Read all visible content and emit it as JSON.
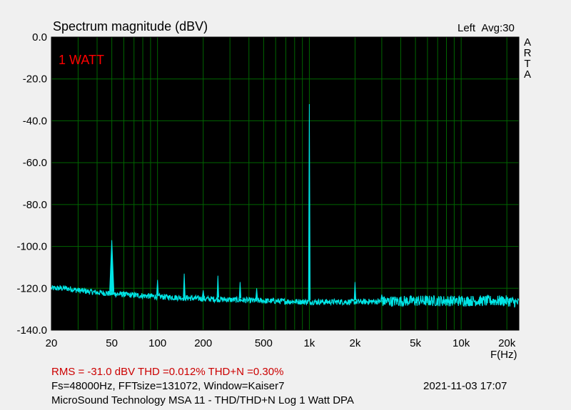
{
  "chart_data": {
    "type": "line",
    "title": "Spectrum magnitude (dBV)",
    "channel_label": "Left",
    "avg_label": "Avg:30",
    "brand": [
      "A",
      "R",
      "T",
      "A"
    ],
    "annotation": "1 WATT",
    "xlabel": "F(Hz)",
    "xscale": "log",
    "xlim": [
      20,
      24000
    ],
    "ylim": [
      -140,
      0
    ],
    "y_ticks": [
      {
        "value": 0,
        "label": "0.0"
      },
      {
        "value": -20,
        "label": "-20.0"
      },
      {
        "value": -40,
        "label": "-40.0"
      },
      {
        "value": -60,
        "label": "-60.0"
      },
      {
        "value": -80,
        "label": "-80.0"
      },
      {
        "value": -100,
        "label": "-100.0"
      },
      {
        "value": -120,
        "label": "-120.0"
      },
      {
        "value": -140,
        "label": "-140.0"
      }
    ],
    "x_ticks": [
      {
        "value": 20,
        "label": "20"
      },
      {
        "value": 50,
        "label": "50"
      },
      {
        "value": 100,
        "label": "100"
      },
      {
        "value": 200,
        "label": "200"
      },
      {
        "value": 500,
        "label": "500"
      },
      {
        "value": 1000,
        "label": "1k"
      },
      {
        "value": 2000,
        "label": "2k"
      },
      {
        "value": 5000,
        "label": "5k"
      },
      {
        "value": 10000,
        "label": "10k"
      },
      {
        "value": 20000,
        "label": "20k"
      }
    ],
    "grid": true,
    "colors": {
      "background": "#000000",
      "grid": "#006600",
      "trace": "#00e5e5",
      "annotation": "#ff0000"
    },
    "noise_floor": [
      [
        20,
        -120
      ],
      [
        25,
        -120
      ],
      [
        30,
        -121
      ],
      [
        40,
        -122
      ],
      [
        60,
        -123
      ],
      [
        100,
        -124
      ],
      [
        200,
        -125
      ],
      [
        500,
        -126
      ],
      [
        1000,
        -126.5
      ],
      [
        2000,
        -126.5
      ],
      [
        5000,
        -126
      ],
      [
        10000,
        -126
      ],
      [
        20000,
        -126
      ],
      [
        24000,
        -127
      ]
    ],
    "peaks": [
      {
        "f": 50,
        "db": -97
      },
      {
        "f": 60,
        "db": -123
      },
      {
        "f": 100,
        "db": -116
      },
      {
        "f": 150,
        "db": -113
      },
      {
        "f": 200,
        "db": -121
      },
      {
        "f": 250,
        "db": -114
      },
      {
        "f": 350,
        "db": -117
      },
      {
        "f": 450,
        "db": -120
      },
      {
        "f": 1000,
        "db": -32
      },
      {
        "f": 2000,
        "db": -117
      },
      {
        "f": 3000,
        "db": -123
      }
    ]
  },
  "footer": {
    "stats": "RMS =  -31.0 dBV   THD =0.012%   THD+N =0.30%",
    "params": "Fs=48000Hz, FFTsize=131072, Window=Kaiser7",
    "device": "MicroSound Technology MSA 11 - THD/THD+N Log 1 Watt     DPA",
    "datetime": "2021-11-03  17:07"
  }
}
